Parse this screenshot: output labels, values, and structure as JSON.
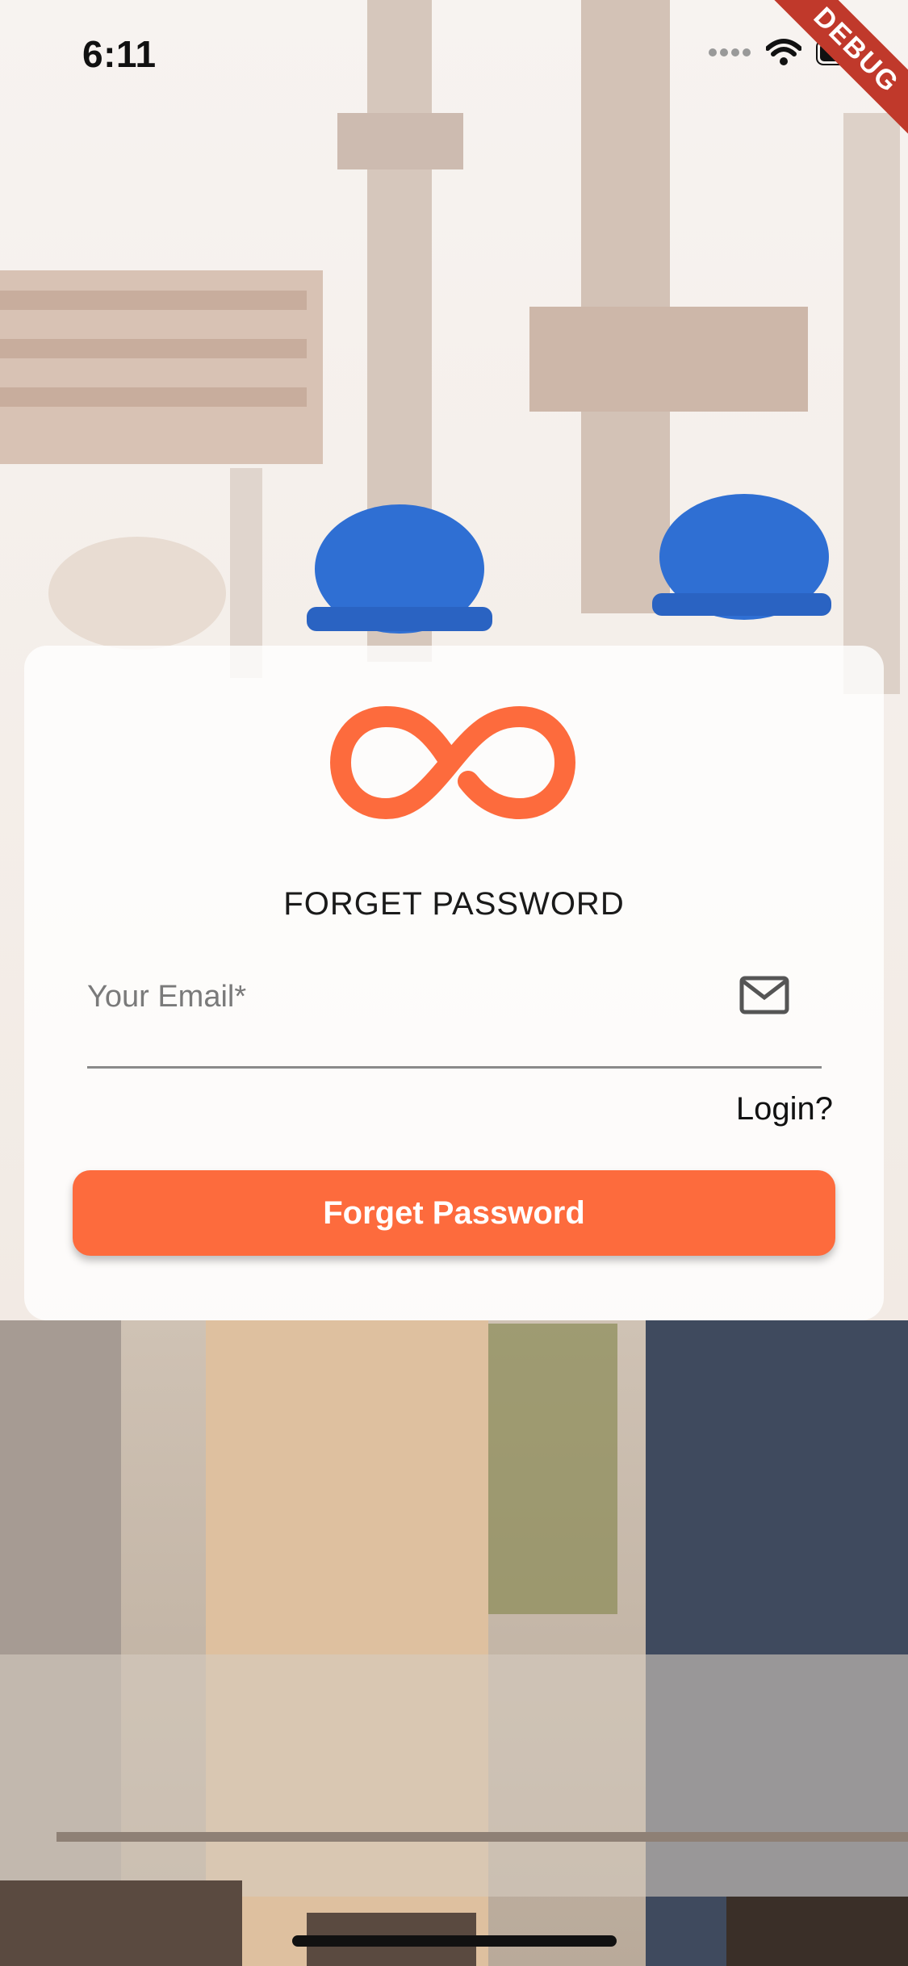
{
  "status_bar": {
    "time": "6:11",
    "icons": [
      "signal-dots-icon",
      "wifi-icon",
      "battery-icon"
    ]
  },
  "debug_banner": "DEBUG",
  "card": {
    "logo": "infinity-logo-icon",
    "title": "FORGET PASSWORD",
    "email": {
      "placeholder": "Your Email*",
      "value": "",
      "icon": "mail-icon"
    },
    "login_link": "Login?",
    "submit_label": "Forget Password"
  },
  "colors": {
    "accent": "#fd6b3d",
    "debug_ribbon": "#c0392b"
  }
}
